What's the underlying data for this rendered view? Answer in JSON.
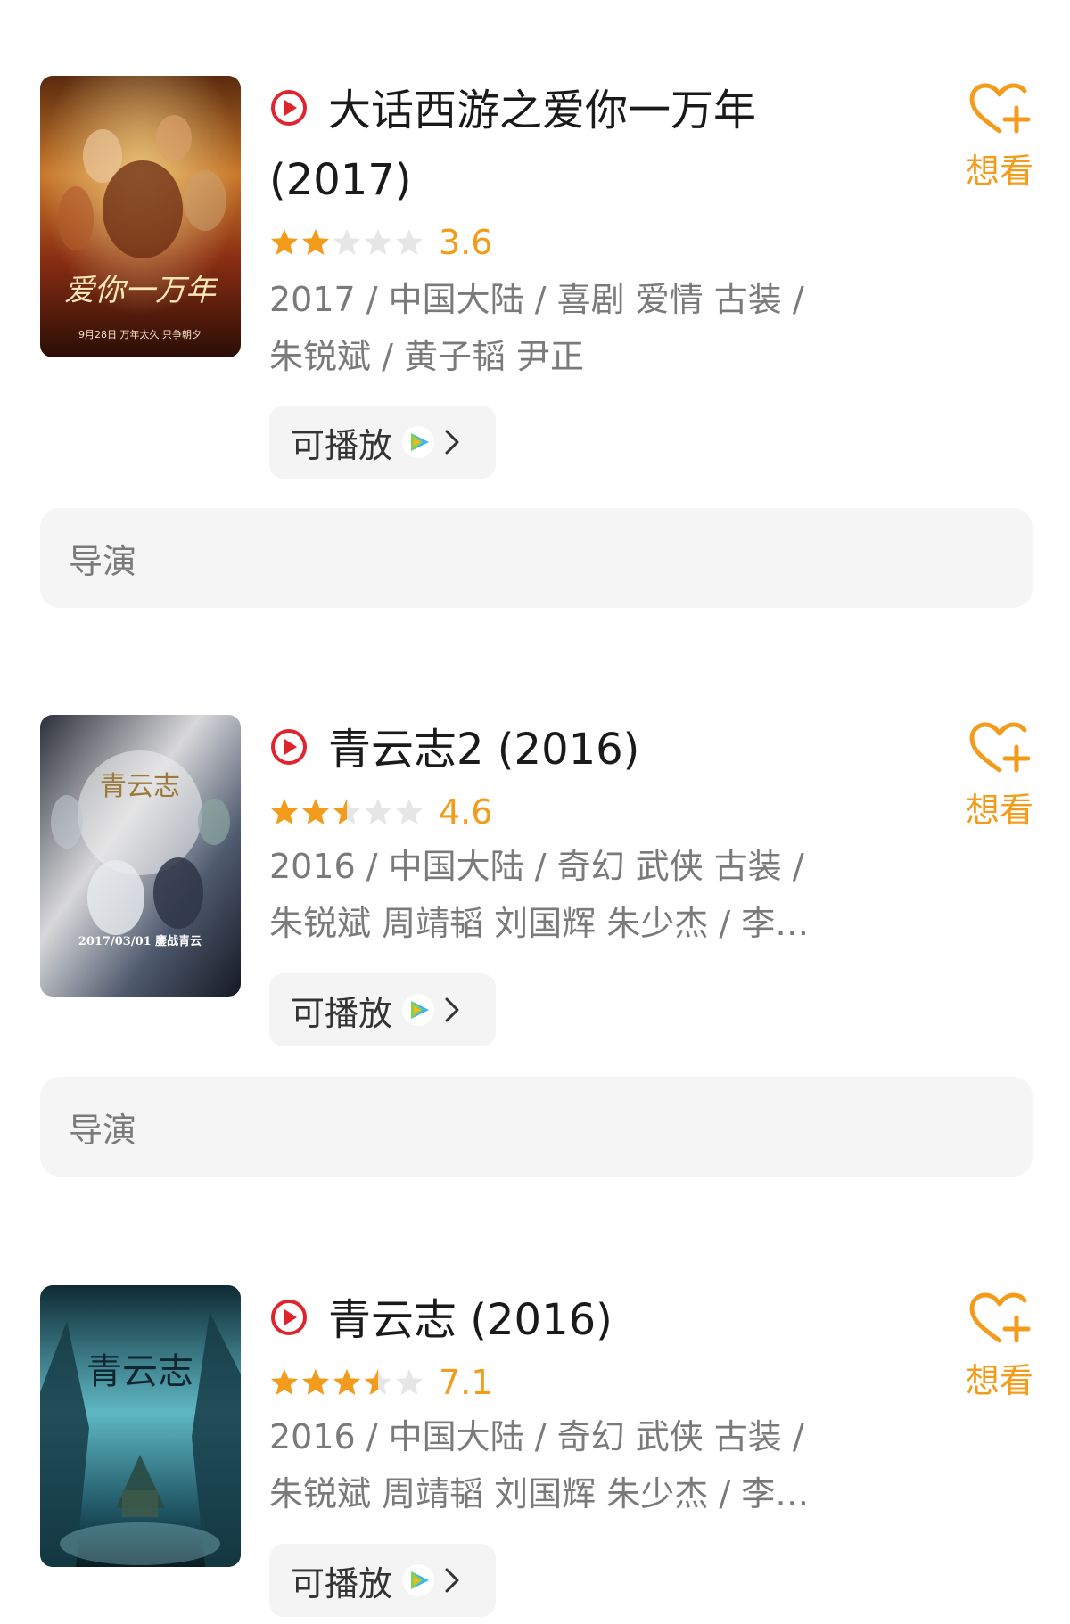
{
  "colors": {
    "accent_orange": "#f39c1b",
    "play_red": "#e0242b",
    "meta_gray": "#7a7a7a",
    "button_bg": "#f4f4f4"
  },
  "movies": [
    {
      "title": "大话西游之爱你一万年 (2017)",
      "rating": 3.6,
      "star_fill_fraction": 0.4,
      "meta_line1": "2017 / 中国大陆 / 喜剧 爱情 古装 /",
      "meta_line2": "朱锐斌 / 黄子韬 尹正",
      "play_label": "可播放",
      "want_label": "想看",
      "director_label": "导演",
      "poster": {
        "text": "爱你一万年",
        "caption": "9月28日 万年太久 只争朝夕"
      }
    },
    {
      "title": "青云志2 (2016)",
      "rating": 4.6,
      "star_fill_fraction": 0.5,
      "meta_line1": "2016 / 中国大陆 / 奇幻 武侠 古装 /",
      "meta_line2": "朱锐斌 周靖韬 刘国辉 朱少杰 / 李…",
      "play_label": "可播放",
      "want_label": "想看",
      "director_label": "导演",
      "poster": {
        "text": "青云志",
        "caption": "2017/03/01 鏖战青云"
      }
    },
    {
      "title": "青云志 (2016)",
      "rating": 7.1,
      "star_fill_fraction": 0.7,
      "meta_line1": "2016 / 中国大陆 / 奇幻 武侠 古装 /",
      "meta_line2": "朱锐斌 周靖韬 刘国辉 朱少杰 / 李…",
      "play_label": "可播放",
      "want_label": "想看",
      "poster": {
        "text": "青云志"
      }
    }
  ],
  "icons": {
    "play": "play-circle-icon",
    "star": "star-icon",
    "video_platform": "tencent-video-icon",
    "chevron": "chevron-right-icon",
    "want": "heart-plus-icon"
  }
}
